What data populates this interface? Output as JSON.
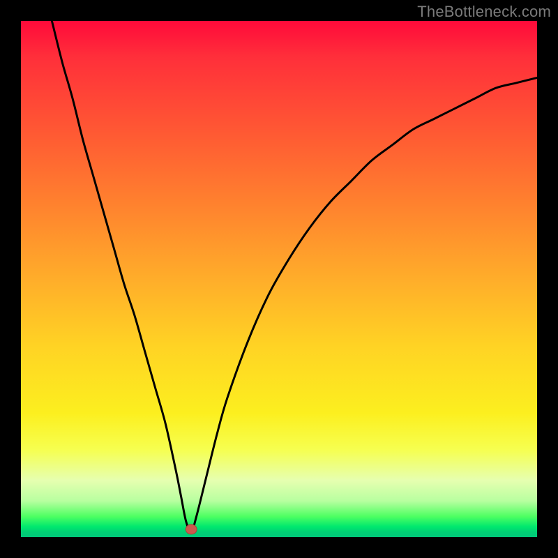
{
  "watermark": "TheBottleneck.com",
  "colors": {
    "frame": "#000000",
    "curve_stroke": "#000000",
    "marker_fill": "#cc5a4e",
    "marker_outline": "#a94438"
  },
  "chart_data": {
    "type": "line",
    "title": "",
    "xlabel": "",
    "ylabel": "",
    "xlim": [
      0,
      100
    ],
    "ylim": [
      0,
      100
    ],
    "grid": false,
    "legend": null,
    "annotations": [],
    "marker": {
      "x": 33,
      "y": 1.5
    },
    "series": [
      {
        "name": "curve",
        "x": [
          6,
          8,
          10,
          12,
          14,
          16,
          18,
          20,
          22,
          24,
          26,
          28,
          30,
          31,
          32,
          33,
          34,
          36,
          38,
          40,
          44,
          48,
          52,
          56,
          60,
          64,
          68,
          72,
          76,
          80,
          84,
          88,
          92,
          96,
          100
        ],
        "values": [
          100,
          92,
          85,
          77,
          70,
          63,
          56,
          49,
          43,
          36,
          29,
          22,
          13,
          8,
          3,
          1,
          4,
          12,
          20,
          27,
          38,
          47,
          54,
          60,
          65,
          69,
          73,
          76,
          79,
          81,
          83,
          85,
          87,
          88,
          89
        ]
      }
    ]
  }
}
